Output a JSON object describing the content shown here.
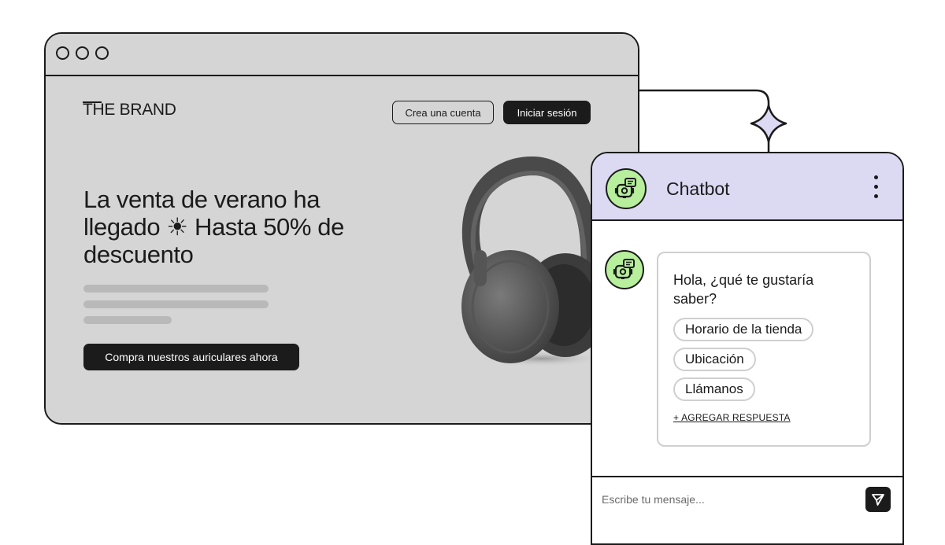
{
  "browser": {
    "brand_logo": "THE BRAND",
    "create_account_label": "Crea una cuenta",
    "sign_in_label": "Iniciar sesión",
    "hero_line1": "La venta de verano ha",
    "hero_line2": "llegado ☀ Hasta 50% de",
    "hero_line3": "descuento",
    "cta_label": "Compra nuestros auriculares ahora"
  },
  "chatbot": {
    "title": "Chatbot",
    "question_line1": "Hola, ¿qué te gustaría",
    "question_line2": "saber?",
    "quick_replies": [
      "Horario de la tienda",
      "Ubicación",
      "Llámanos"
    ],
    "add_reply_label": "+ AGREGAR RESPUESTA",
    "input_placeholder": "Escribe tu mensaje..."
  },
  "colors": {
    "header_bg": "#dcdaf3",
    "avatar_bg": "#b7ef9c",
    "browser_bg": "#d5d5d5",
    "ink": "#1b1b1b"
  },
  "icons": [
    "bot-icon",
    "kebab-menu-icon",
    "send-icon",
    "sun-icon",
    "sparkle-icon"
  ]
}
